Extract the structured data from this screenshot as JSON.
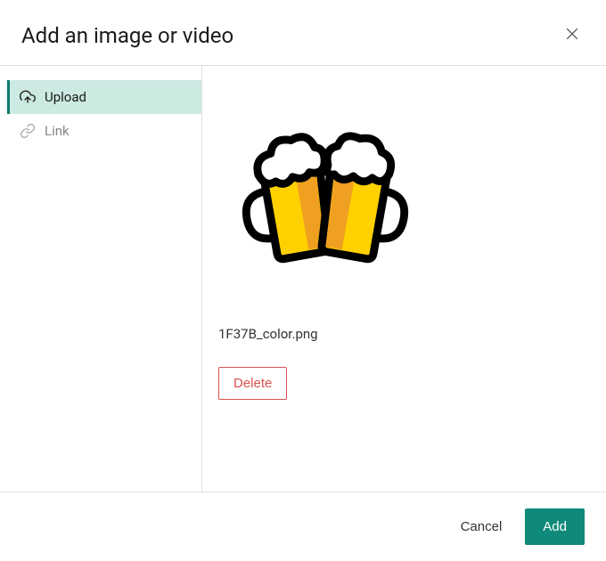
{
  "header": {
    "title": "Add an image or video"
  },
  "sidebar": {
    "tabs": [
      {
        "label": "Upload",
        "icon": "upload-cloud-icon",
        "active": true
      },
      {
        "label": "Link",
        "icon": "link-icon",
        "active": false
      }
    ]
  },
  "content": {
    "filename": "1F37B_color.png",
    "delete_label": "Delete"
  },
  "footer": {
    "cancel_label": "Cancel",
    "add_label": "Add"
  }
}
